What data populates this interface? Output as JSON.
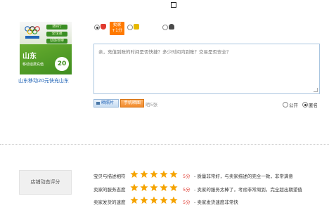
{
  "product": {
    "image_tags": [
      "随e行",
      "全球通",
      "动感地带"
    ],
    "image_province": "山东",
    "image_subtitle": "移动话费充值",
    "image_amount": "20",
    "title": "山东移动20元快充山东"
  },
  "rating_options": {
    "good": {
      "selected": true,
      "bonus_label": "卖家\n+1分"
    },
    "neutral": {
      "selected": false
    },
    "bad": {
      "selected": false
    }
  },
  "review": {
    "placeholder": "亲，充值到账的时间是否快捷？多少时间内到账？交易是否安全？"
  },
  "toolbar": {
    "photo_button": "晒照片",
    "phone_button": "手机晒图",
    "anon_note": "晒5张"
  },
  "visibility": {
    "public_label": "公开",
    "anonymous_label": "匿名",
    "selected": "anonymous"
  },
  "store_rating": {
    "title": "店铺动态评分",
    "rows": [
      {
        "label": "宝贝与描述相符",
        "stars": 5,
        "score": "5分",
        "desc": "- 质量非常好，与卖家描述的完全一致，非常满意"
      },
      {
        "label": "卖家的服务态度",
        "stars": 5,
        "score": "5分",
        "desc": "- 卖家的服务太棒了，考虑非常周到，完全超出期望值"
      },
      {
        "label": "卖家发货的速度",
        "stars": 5,
        "score": "5分",
        "desc": "- 卖家发货速度非常快"
      }
    ]
  },
  "colors": {
    "star": "#f5a300",
    "score": "#e03a2f",
    "link": "#1a5fb4"
  }
}
